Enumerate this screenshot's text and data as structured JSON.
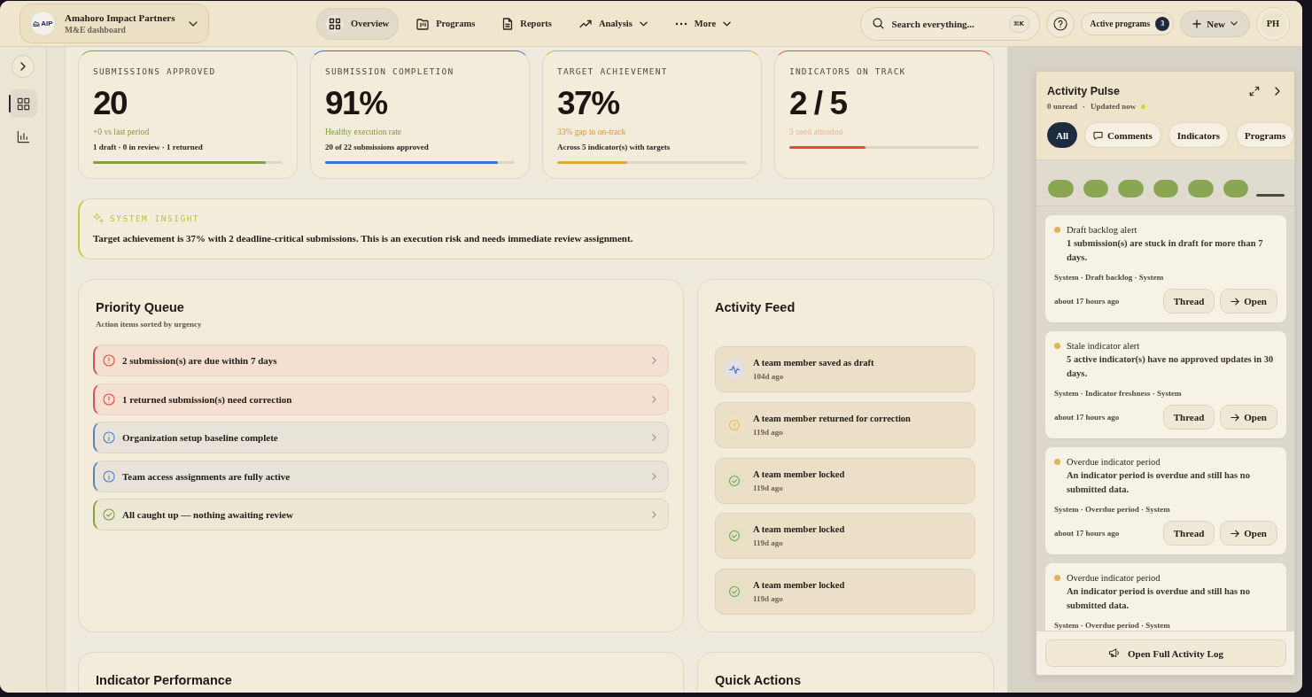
{
  "topbar": {
    "logo_text": "AIP",
    "org_name": "Amahoro Impact Partners",
    "org_subtitle": "M&E dashboard",
    "nav": [
      {
        "label": "Overview",
        "selected": true,
        "dropdown": false
      },
      {
        "label": "Programs",
        "selected": false,
        "dropdown": false
      },
      {
        "label": "Reports",
        "selected": false,
        "dropdown": false
      },
      {
        "label": "Analysis",
        "selected": false,
        "dropdown": true
      },
      {
        "label": "More",
        "selected": false,
        "dropdown": true
      }
    ],
    "search": {
      "placeholder": "Search everything...",
      "shortcut": "⌘K"
    },
    "active_programs": {
      "label": "Active programs",
      "count": "3"
    },
    "new_button": "New",
    "avatar": "PH"
  },
  "sidebar": {
    "items": [
      {
        "selected": true
      },
      {
        "selected": false
      }
    ]
  },
  "stats": [
    {
      "kind": "positive",
      "label": "SUBMISSIONS APPROVED",
      "value": "20",
      "trend": "+0 vs last period",
      "detail": "1 draft · 0 in review · 1 returned",
      "level": 0.91,
      "color": "#7ba23f"
    },
    {
      "kind": "positive",
      "label": "SUBMISSION COMPLETION",
      "value": "91%",
      "trend": "Healthy execution rate",
      "detail": "20 of 22 submissions approved",
      "level": 0.91,
      "color": "#3b6fd0"
    },
    {
      "kind": "warning",
      "label": "TARGET ACHIEVEMENT",
      "value": "37%",
      "trend": "33% gap to on-track",
      "detail": "Across 5 indicator(s) with targets",
      "level": 0.37,
      "color": "#e0a83c"
    },
    {
      "kind": "faint",
      "label": "INDICATORS ON TRACK",
      "value": "2 / 5",
      "trend": "3 need attention",
      "level": 0.4,
      "color": "#e5483c"
    }
  ],
  "insight": {
    "label": "SYSTEM INSIGHT",
    "text": "Target achievement is 37% with 2 deadline-critical submissions. This is an execution risk and needs immediate review assignment."
  },
  "priority_queue": {
    "title": "Priority Queue",
    "subtitle": "Action items sorted by urgency",
    "items": [
      {
        "kind": "alert",
        "text": "2 submission(s) are due within 7 days"
      },
      {
        "kind": "alert",
        "text": "1 returned submission(s) need correction"
      },
      {
        "kind": "info",
        "text": "Organization setup baseline complete"
      },
      {
        "kind": "info",
        "text": "Team access assignments are fully active"
      },
      {
        "kind": "success",
        "text": "All caught up — nothing awaiting review"
      }
    ]
  },
  "activity_feed": {
    "title": "Activity Feed",
    "items": [
      {
        "kind": "draft",
        "title": "A team member saved as draft",
        "time": "104d ago"
      },
      {
        "kind": "returned",
        "title": "A team member returned for correction",
        "time": "119d ago"
      },
      {
        "kind": "locked",
        "title": "A team member locked",
        "time": "119d ago"
      },
      {
        "kind": "locked",
        "title": "A team member locked",
        "time": "119d ago"
      },
      {
        "kind": "locked",
        "title": "A team member locked",
        "time": "119d ago"
      }
    ]
  },
  "bottom_cards": [
    {
      "title": "Indicator Performance"
    },
    {
      "title": "Quick Actions"
    }
  ],
  "activity_pulse": {
    "title": "Activity Pulse",
    "status": [
      "0 unread",
      "·",
      "Updated now"
    ],
    "live": true,
    "filters": [
      {
        "label": "All",
        "selected": true,
        "kind": "plain"
      },
      {
        "label": "Comments",
        "selected": false,
        "kind": "iconed"
      },
      {
        "label": "Indicators",
        "selected": false,
        "kind": "plain"
      },
      {
        "label": "Programs",
        "selected": false,
        "kind": "plain"
      }
    ],
    "notifications": [
      {
        "title": "Draft backlog alert",
        "body": "1 submission(s) are stuck in draft for more than 7 days.",
        "meta": "System · Draft backlog · System",
        "time": "about 17 hours ago",
        "actions": [
          {
            "label": "Thread",
            "kind": "plain"
          },
          {
            "label": "Open",
            "kind": "link"
          }
        ]
      },
      {
        "title": "Stale indicator alert",
        "body": "5 active indicator(s) have no approved updates in 30 days.",
        "meta": "System · Indicator freshness · System",
        "time": "about 17 hours ago",
        "actions": [
          {
            "label": "Thread",
            "kind": "plain"
          },
          {
            "label": "Open",
            "kind": "link"
          }
        ]
      },
      {
        "title": "Overdue indicator period",
        "body": "An indicator period is overdue and still has no submitted data.",
        "meta": "System · Overdue period · System",
        "time": "about 17 hours ago",
        "actions": [
          {
            "label": "Thread",
            "kind": "plain"
          },
          {
            "label": "Open",
            "kind": "link"
          }
        ]
      },
      {
        "title": "Overdue indicator period",
        "body": "An indicator period is overdue and still has no submitted data.",
        "meta": "System · Overdue period · System"
      }
    ],
    "footer_button": "Open Full Activity Log"
  }
}
